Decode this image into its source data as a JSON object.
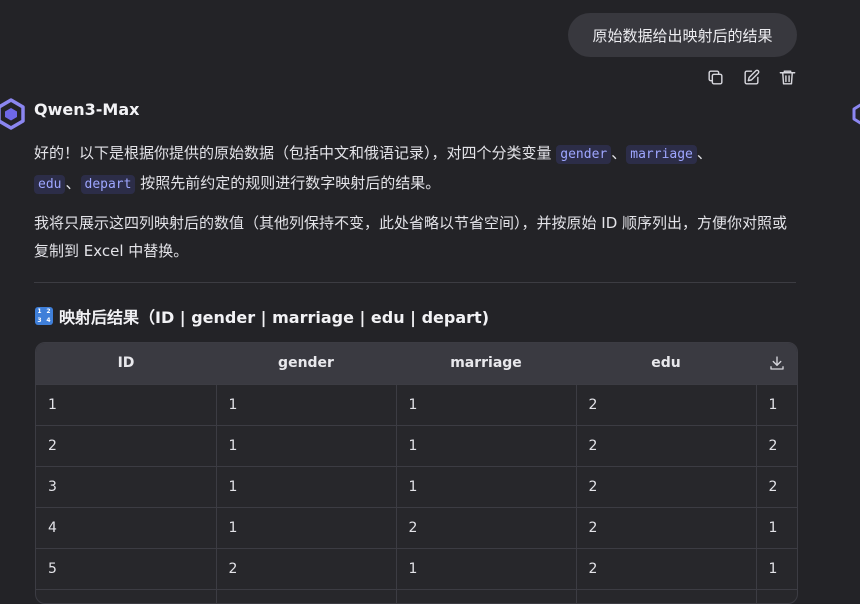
{
  "user_message": {
    "text": "原始数据给出映射后的结果"
  },
  "message_actions": [
    "copy-icon",
    "edit-icon",
    "delete-icon"
  ],
  "assistant": {
    "name": "Qwen3-Max",
    "para1": {
      "before": "好的！以下是根据你提供的原始数据（包括中文和俄语记录），对四个分类变量 ",
      "codes": [
        "gender",
        "marriage",
        "edu",
        "depart"
      ],
      "sep": "、",
      "after": " 按照先前约定的规则进行数字映射后的结果。"
    },
    "para2": "我将只展示这四列映射后的数值（其他列保持不变，此处省略以节省空间），并按原始 ID 顺序列出，方便你对照或复制到 Excel 中替换。",
    "section_title": "映射后结果（ID | gender | marriage | edu | depart)",
    "section_icon_text": [
      "1",
      "2",
      "3",
      "4"
    ]
  },
  "table": {
    "headers": [
      "ID",
      "gender",
      "marriage",
      "edu"
    ],
    "rows": [
      [
        "1",
        "1",
        "1",
        "2",
        "1"
      ],
      [
        "2",
        "1",
        "1",
        "2",
        "2"
      ],
      [
        "3",
        "1",
        "1",
        "2",
        "2"
      ],
      [
        "4",
        "1",
        "2",
        "2",
        "1"
      ],
      [
        "5",
        "2",
        "1",
        "2",
        "1"
      ],
      [
        "",
        "",
        "",
        "",
        ""
      ]
    ]
  },
  "colors": {
    "background": "#232327",
    "bubble": "#38383e",
    "code_text": "#9ea6ff",
    "code_bg": "#2c2d48",
    "table_header": "#3a3a41"
  }
}
